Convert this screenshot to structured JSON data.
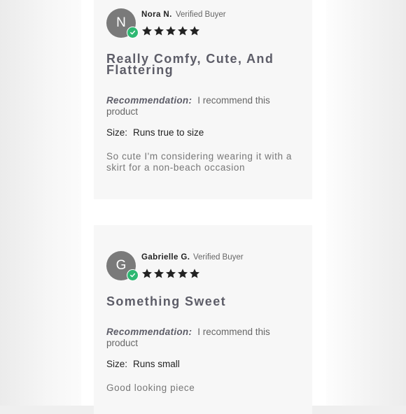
{
  "reviews": [
    {
      "avatar_initial": "N",
      "reviewer_name": "Nora N.",
      "verified_label": "Verified Buyer",
      "rating": 5,
      "title": "Really Comfy, Cute, And Flattering",
      "recommendation_label": "Recommendation:",
      "recommendation_value": "I recommend this product",
      "size_label": "Size:",
      "size_value": "Runs true to size",
      "body": "So cute I'm considering wearing it with a skirt for a non-beach occasion"
    },
    {
      "avatar_initial": "G",
      "reviewer_name": "Gabrielle G.",
      "verified_label": "Verified Buyer",
      "rating": 5,
      "title": "Something Sweet",
      "recommendation_label": "Recommendation:",
      "recommendation_value": "I recommend this product",
      "size_label": "Size:",
      "size_value": "Runs small",
      "body": "Good looking piece"
    }
  ],
  "colors": {
    "avatar": "#7a7a7a",
    "verified_badge": "#2eb872",
    "star": "#222222",
    "card_background": "#f7f7f7"
  }
}
